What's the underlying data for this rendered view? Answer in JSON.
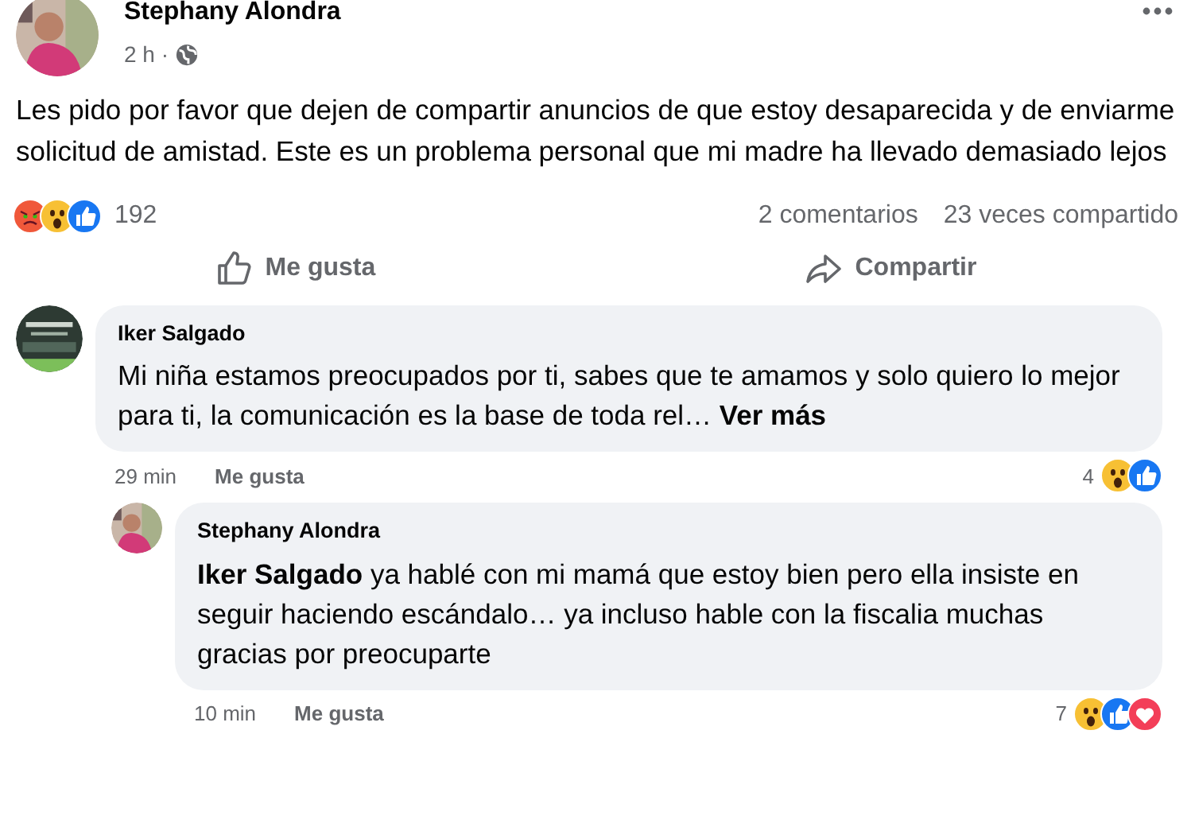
{
  "post": {
    "author": "Stephany Alondra",
    "time": "2 h ·",
    "text": "Les pido por favor que dejen de compartir anuncios de que estoy desaparecida y de enviarme solicitud de amistad. Este es un problema personal que mi madre ha llevado demasiado lejos",
    "reactions": [
      {
        "kind": "angry"
      },
      {
        "kind": "wow"
      },
      {
        "kind": "like"
      }
    ],
    "reaction_count": "192",
    "comments_count": "2 comentarios",
    "shares_count": "23 veces compartido",
    "actions": [
      {
        "kind": "like",
        "label": "Me gusta"
      },
      {
        "kind": "share",
        "label": "Compartir"
      }
    ]
  },
  "comments": [
    {
      "author": "Iker Salgado",
      "text": "Mi niña estamos preocupados por ti, sabes que te amamos y solo quiero lo mejor para ti, la comunicación es la base de toda rel… **Ver más**",
      "time": "29 min",
      "like": "Me gusta",
      "count": "4",
      "reactions": [
        {
          "kind": "wow"
        },
        {
          "kind": "like"
        }
      ],
      "reply": false
    },
    {
      "author": "Stephany Alondra",
      "text": "**Iker Salgado** ya hablé con mi mamá que estoy bien pero ella insiste en seguir haciendo escándalo… ya incluso hable con la fiscalia muchas gracias por preocuparte",
      "time": "10 min",
      "like": "Me gusta",
      "count": "7",
      "reactions": [
        {
          "kind": "wow"
        },
        {
          "kind": "like"
        },
        {
          "kind": "love"
        }
      ],
      "reply": true
    }
  ]
}
